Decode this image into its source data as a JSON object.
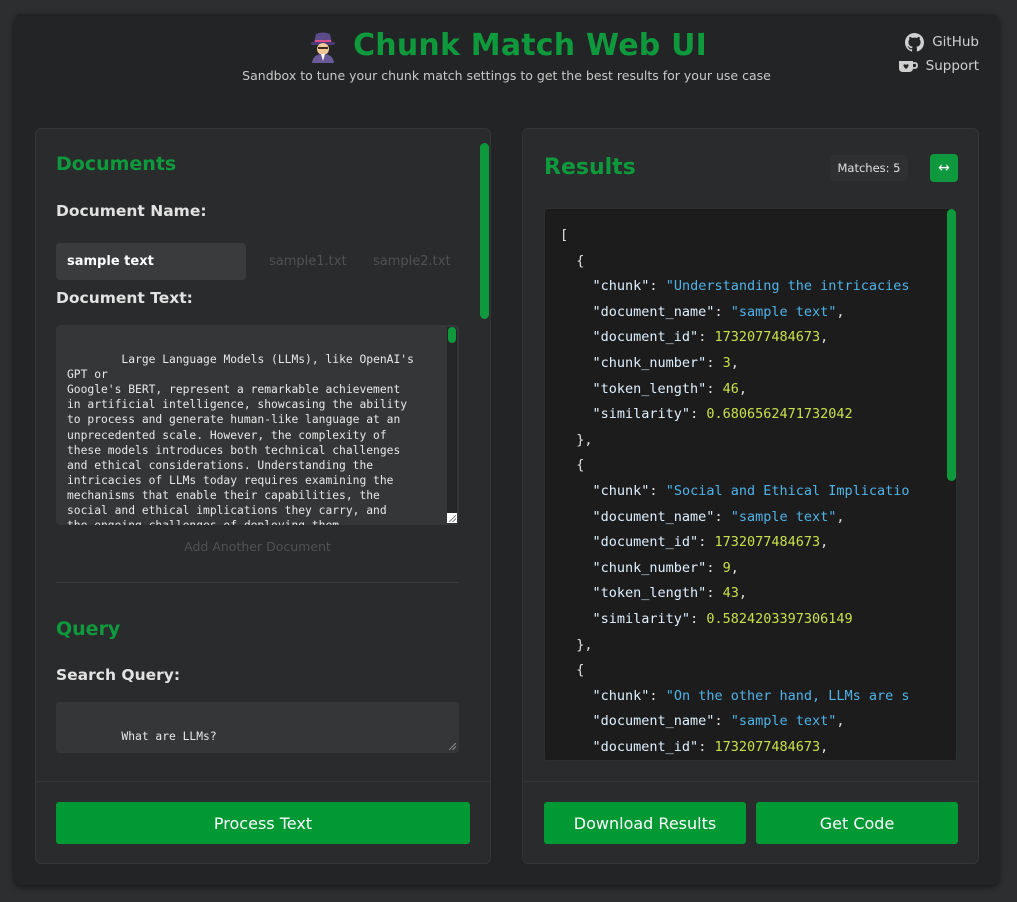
{
  "app": {
    "title": "Chunk Match Web UI",
    "subtitle": "Sandbox to tune your chunk match settings to get the best results for your use case",
    "emoji_icon": "detective-emoji-icon"
  },
  "links": {
    "github": "GitHub",
    "support": "Support"
  },
  "documents": {
    "section_title": "Documents",
    "name_label": "Document Name:",
    "tabs": [
      "sample text",
      "sample1.txt",
      "sample2.txt"
    ],
    "text_label": "Document Text:",
    "text": "Large Language Models (LLMs), like OpenAI's GPT or\nGoogle's BERT, represent a remarkable achievement\nin artificial intelligence, showcasing the ability\nto process and generate human-like language at an\nunprecedented scale. However, the complexity of\nthese models introduces both technical challenges\nand ethical considerations. Understanding the\nintricacies of LLMs today requires examining the\nmechanisms that enable their capabilities, the\nsocial and ethical implications they carry, and\nthe ongoing challenges of deploying them\nresponsibly.",
    "add_label": "Add Another Document"
  },
  "query": {
    "section_title": "Query",
    "label": "Search Query:",
    "value": "What are LLMs?"
  },
  "buttons": {
    "process": "Process Text",
    "download": "Download Results",
    "code": "Get Code"
  },
  "results": {
    "title": "Results",
    "matches": "Matches: 5",
    "expand_icon": "↔",
    "items": [
      {
        "chunk": "Understanding the intricacies",
        "document_name": "sample text",
        "document_id": "1732077484673",
        "chunk_number": "3",
        "token_length": "46",
        "similarity": "0.6806562471732042"
      },
      {
        "chunk": "Social and Ethical Implicatio",
        "document_name": "sample text",
        "document_id": "1732077484673",
        "chunk_number": "9",
        "token_length": "43",
        "similarity": "0.5824203397306149"
      },
      {
        "chunk": "On the other hand, LLMs are s",
        "document_name": "sample text",
        "document_id": "1732077484673"
      }
    ]
  },
  "colors": {
    "accent": "#0e9a3c",
    "button": "#009933",
    "string": "#4fb3e8",
    "number": "#c8e14a"
  }
}
